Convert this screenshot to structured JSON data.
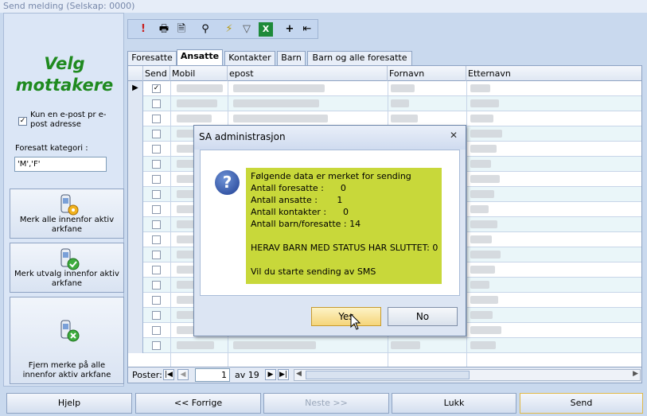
{
  "window": {
    "title": "Send melding (Selskap: 0000)"
  },
  "left": {
    "heading_line1": "Velg",
    "heading_line2": "mottakere",
    "one_email_label": "Kun en e-post pr e-post adresse",
    "one_email_checked": true,
    "category_label": "Foresatt kategori :",
    "category_value": "'M','F'",
    "buttons": [
      {
        "label": "Merk alle innenfor aktiv arkfane",
        "icon": "phone-gear-icon"
      },
      {
        "label": "Merk utvalg innenfor aktiv arkfane",
        "icon": "phone-check-icon"
      },
      {
        "label": "Fjern merke på alle innenfor aktiv arkfane",
        "icon": "phone-remove-icon"
      }
    ]
  },
  "toolbar": {
    "icons": [
      "exclamation-icon",
      "printer-icon",
      "print-preview-icon",
      "binoculars-icon",
      "filter-lightning-icon",
      "filter-icon",
      "excel-icon",
      "add-icon",
      "collapse-icon"
    ]
  },
  "tabs": [
    "Foresatte",
    "Ansatte",
    "Kontakter",
    "Barn",
    "Barn og alle foresatte"
  ],
  "active_tab": "Ansatte",
  "grid": {
    "columns": [
      "Send",
      "Mobil",
      "epost",
      "Fornavn",
      "Etternavn"
    ],
    "first_row_checked": true,
    "row_count": 18
  },
  "navigator": {
    "label": "Poster:",
    "current": "1",
    "total": "av 19"
  },
  "bottom": {
    "help": "Hjelp",
    "prev": "<< Forrige",
    "next": "Neste >>",
    "close": "Lukk",
    "send": "Send"
  },
  "dialog": {
    "title": "SA administrasjon",
    "lines": [
      "Følgende data er merket for sending",
      "Antall foresatte :      0",
      "Antall ansatte :       1",
      "Antall kontakter :      0",
      "Antall barn/foresatte : 14",
      "",
      "HERAV BARN MED STATUS HAR SLUTTET: 0",
      "",
      "Vil du starte sending av SMS"
    ],
    "yes": "Yes",
    "no": "No"
  }
}
